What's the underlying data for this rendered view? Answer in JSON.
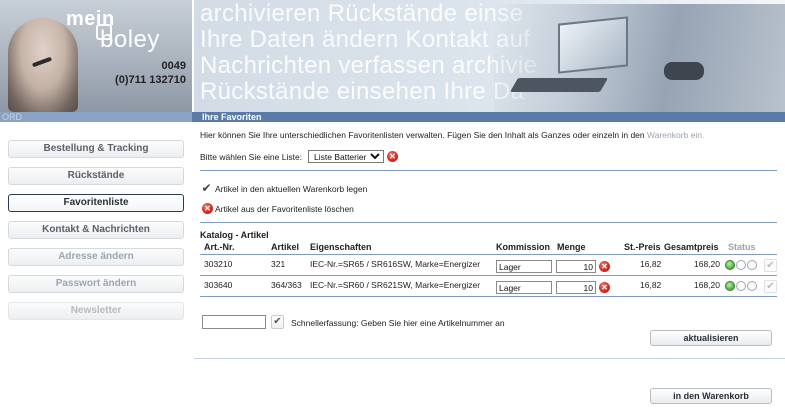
{
  "header": {
    "logo_mein": "mein",
    "logo_boley": "boley",
    "phone_line1": "0049",
    "phone_line2": "(0)711 132710",
    "banner_lines": [
      "archivieren Rückstände einse",
      "Ihre Daten ändern Kontakt auf",
      "Nachrichten verfassen archivie",
      "Rückstände einsehen Ihre Da"
    ]
  },
  "strip": {
    "left_text": "ORD",
    "title": "Ihre Favoriten"
  },
  "sidebar": {
    "items": [
      {
        "label": "Bestellung & Tracking",
        "state": "normal"
      },
      {
        "label": "Rückstände",
        "state": "normal"
      },
      {
        "label": "Favoritenliste",
        "state": "active"
      },
      {
        "label": "Kontakt & Nachrichten",
        "state": "normal"
      },
      {
        "label": "Adresse ändern",
        "state": "dim"
      },
      {
        "label": "Passwort ändern",
        "state": "dim"
      },
      {
        "label": "Newsletter",
        "state": "fade"
      }
    ]
  },
  "main": {
    "intro_text": "Hier können Sie Ihre unterschiedlichen Favoritenlisten verwalten. Fügen Sie den Inhalt als Ganzes oder einzeln in den",
    "intro_text_light": "Warenkorb ein.",
    "list_label": "Bitte wählen Sie eine Liste:",
    "list_selected": "Liste Batterien",
    "action_add_cart": "Artikel in den aktuellen Warenkorb legen",
    "action_delete": "Artikel aus der Favoritenliste löschen",
    "table": {
      "title": "Katalog - Artikel",
      "headers": {
        "art_nr": "Art.-Nr.",
        "artikel": "Artikel",
        "eigenschaften": "Eigenschaften",
        "kommission": "Kommission",
        "menge": "Menge",
        "st_preis": "St.-Preis",
        "gesamtpreis": "Gesamtpreis",
        "status": "Status"
      },
      "rows": [
        {
          "art_nr": "303210",
          "artikel": "321",
          "eigenschaften": "IEC-Nr.=SR65 / SR616SW, Marke=Energizer",
          "kommission": "Lager",
          "menge": "10",
          "st_preis": "16,82",
          "gesamtpreis": "168,20"
        },
        {
          "art_nr": "303640",
          "artikel": "364/363",
          "eigenschaften": "IEC-Nr.=SR60 / SR621SW, Marke=Energizer",
          "kommission": "Lager",
          "menge": "10",
          "st_preis": "16,82",
          "gesamtpreis": "168,20"
        }
      ]
    },
    "quick_entry_text": "Schnellerfassung: Geben Sie hier eine Artikelnummer an",
    "quick_entry_value": "",
    "update_button": "aktualisieren",
    "cart_button": "in den Warenkorb"
  },
  "colors": {
    "strip_blue": "#5a7aa8",
    "rule_blue": "#7f9bc1",
    "delete_red": "#d2261b",
    "status_green": "#5dbb45"
  },
  "icons": {
    "check": "check-icon",
    "delete": "delete-x-icon",
    "status_dot": "status-dot-icon"
  }
}
